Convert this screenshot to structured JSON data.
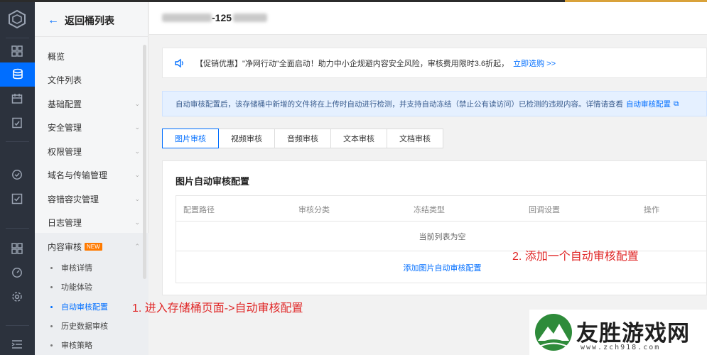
{
  "header": {
    "bucket_suffix": "-125"
  },
  "sidebar": {
    "back_label": "返回桶列表",
    "items": [
      {
        "label": "概览",
        "has_chevron": false
      },
      {
        "label": "文件列表",
        "has_chevron": false
      },
      {
        "label": "基础配置",
        "has_chevron": true
      },
      {
        "label": "安全管理",
        "has_chevron": true
      },
      {
        "label": "权限管理",
        "has_chevron": true
      },
      {
        "label": "域名与传输管理",
        "has_chevron": true
      },
      {
        "label": "容错容灾管理",
        "has_chevron": true
      },
      {
        "label": "日志管理",
        "has_chevron": true
      },
      {
        "label": "内容审核",
        "badge": "NEW",
        "has_chevron": true
      }
    ],
    "sub_items": [
      {
        "label": "审核详情",
        "active": false
      },
      {
        "label": "功能体验",
        "active": false
      },
      {
        "label": "自动审核配置",
        "active": true
      },
      {
        "label": "历史数据审核",
        "active": false
      },
      {
        "label": "审核策略",
        "active": false
      }
    ]
  },
  "promo": {
    "text": "【促销优惠】\"净网行动\"全面启动！助力中小企规避内容安全风险，审核费用限时3.6折起，",
    "link": "立即选购 >>"
  },
  "info": {
    "text": "自动审核配置后，该存储桶中新增的文件将在上传时自动进行检测，并支持自动冻结（禁止公有读访问）已检测的违规内容。详情请查看",
    "link": "自动审核配置"
  },
  "tabs": [
    {
      "label": "图片审核",
      "active": true
    },
    {
      "label": "视频审核",
      "active": false
    },
    {
      "label": "音频审核",
      "active": false
    },
    {
      "label": "文本审核",
      "active": false
    },
    {
      "label": "文档审核",
      "active": false
    }
  ],
  "card": {
    "title": "图片自动审核配置",
    "columns": [
      "配置路径",
      "审核分类",
      "冻结类型",
      "回调设置",
      "操作"
    ],
    "empty_text": "当前列表为空",
    "add_link": "添加图片自动审核配置"
  },
  "annotations": {
    "step1": "1. 进入存储桶页面->自动审核配置",
    "step2": "2. 添加一个自动审核配置"
  },
  "watermark": {
    "name": "友胜游戏网",
    "url": "www.zch918.com"
  },
  "colors": {
    "accent": "#006eff",
    "rail_bg": "#2c323d",
    "annotation": "#e02828",
    "new_badge": "#ff7a00"
  }
}
